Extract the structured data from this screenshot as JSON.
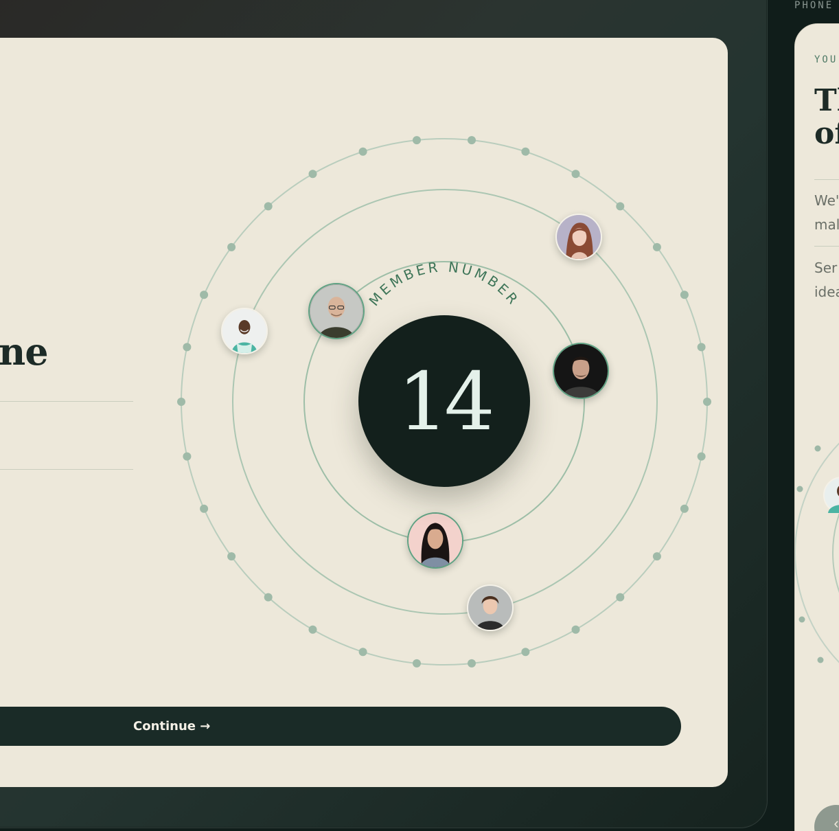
{
  "tablet": {
    "headline_fragment": "ne",
    "orbit": {
      "label": "MEMBER NUMBER",
      "member_number": "14"
    },
    "avatars": [
      {
        "name": "avatar-woman-red-hair"
      },
      {
        "name": "avatar-man-bald-glasses"
      },
      {
        "name": "avatar-man-teal-shirt"
      },
      {
        "name": "avatar-man-dark-hair"
      },
      {
        "name": "avatar-woman-dark-hair"
      },
      {
        "name": "avatar-young-man"
      }
    ],
    "continue_label": "Continue →"
  },
  "phone": {
    "label": "PHONE",
    "eyebrow": "YOU",
    "title_line_1": "Tl",
    "title_line_2": "of",
    "text_line_1": "We'",
    "text_line_2": "mal",
    "text_line_3": "Ser",
    "text_line_4": "idea",
    "back_label": "‹"
  },
  "colors": {
    "background": "#101d1a",
    "screen": "#ede8da",
    "dark": "#13201c",
    "orbit_line": "#a9c4b1",
    "accent": "#5fa283"
  }
}
